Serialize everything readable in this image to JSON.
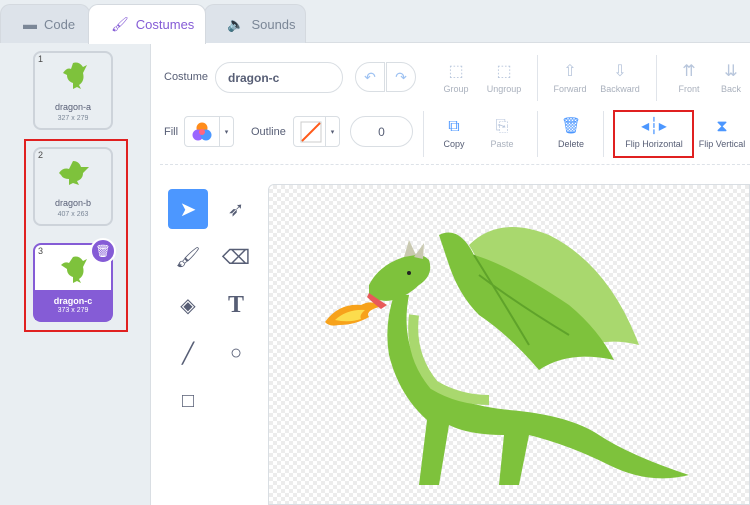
{
  "tabs": [
    {
      "label": "Code",
      "icon": "code-icon"
    },
    {
      "label": "Costumes",
      "icon": "paintbrush-icon"
    },
    {
      "label": "Sounds",
      "icon": "speaker-icon"
    }
  ],
  "costumes": [
    {
      "num": "1",
      "name": "dragon-a",
      "size": "327 x 279"
    },
    {
      "num": "2",
      "name": "dragon-b",
      "size": "407 x 263"
    },
    {
      "num": "3",
      "name": "dragon-c",
      "size": "373 x 279"
    }
  ],
  "editor": {
    "costume_label": "Costume",
    "costume_name": "dragon-c",
    "fill_label": "Fill",
    "outline_label": "Outline",
    "outline_width": "0"
  },
  "toolbar": {
    "group": "Group",
    "ungroup": "Ungroup",
    "forward": "Forward",
    "backward": "Backward",
    "front": "Front",
    "back": "Back",
    "copy": "Copy",
    "paste": "Paste",
    "delete": "Delete",
    "flip_h": "Flip Horizontal",
    "flip_v": "Flip Vertical"
  },
  "colors": {
    "accent": "#855cd6",
    "blue": "#4c97ff",
    "highlight": "#e02020",
    "dragon": "#7ec23c"
  }
}
